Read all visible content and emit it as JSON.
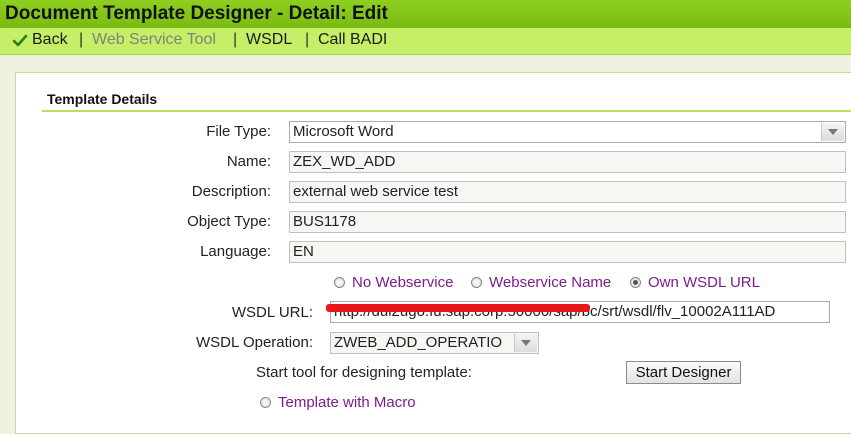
{
  "window": {
    "title": "Document Template Designer - Detail: Edit"
  },
  "toolbar": {
    "back_label": "Back",
    "web_service_tool_label": "Web Service Tool",
    "wsdl_label": "WSDL",
    "call_badi_label": "Call BADI",
    "separator": "|"
  },
  "section": {
    "title": "Template Details"
  },
  "form": {
    "file_type": {
      "label": "File Type:",
      "value": "Microsoft Word"
    },
    "name": {
      "label": "Name:",
      "value": "ZEX_WD_ADD"
    },
    "description": {
      "label": "Description:",
      "value": "external web service test"
    },
    "object_type": {
      "label": "Object Type:",
      "value": "BUS1178"
    },
    "language": {
      "label": "Language:",
      "value": "EN"
    },
    "webservice_options": [
      {
        "label": "No Webservice",
        "selected": false
      },
      {
        "label": "Webservice Name",
        "selected": false
      },
      {
        "label": "Own WSDL URL",
        "selected": true
      }
    ],
    "wsdl_url": {
      "label": "WSDL URL:",
      "value": "http://dul2ugo.fu.sap.corp:50000/sap/bc/srt/wsdl/flv_10002A111AD"
    },
    "wsdl_operation": {
      "label": "WSDL Operation:",
      "value": "ZWEB_ADD_OPERATIO"
    },
    "start_tool_text": "Start tool for designing template:",
    "start_designer_label": "Start Designer",
    "template_macro": {
      "label": "Template with Macro",
      "selected": false
    }
  },
  "colors": {
    "title_bar": "#7abb14",
    "toolbar": "#c5ef66",
    "radio_text": "#7a1f8a",
    "redaction": "#e81818"
  }
}
